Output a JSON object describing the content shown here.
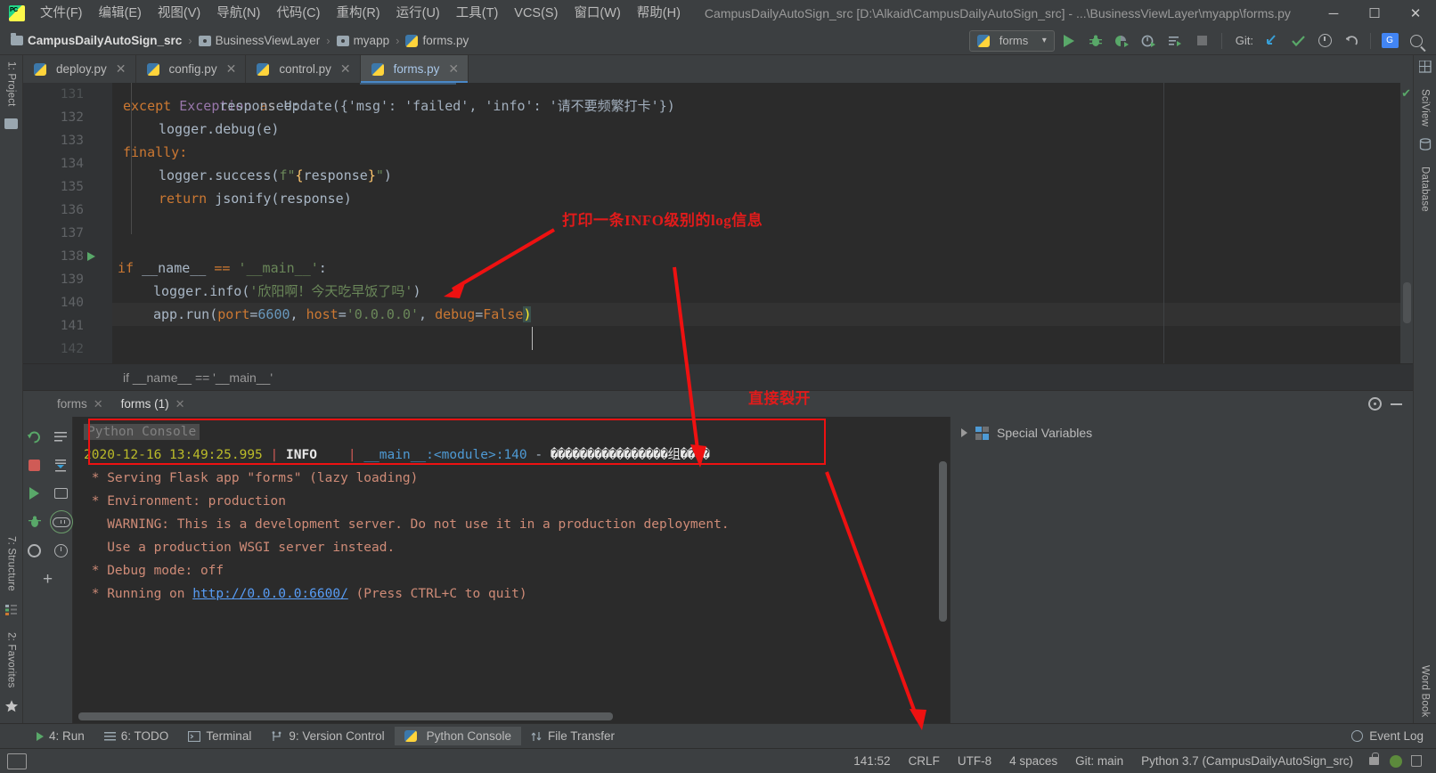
{
  "window": {
    "title": "CampusDailyAutoSign_src [D:\\Alkaid\\CampusDailyAutoSign_src] - ...\\BusinessViewLayer\\myapp\\forms.py",
    "minimize": "─",
    "maximize": "☐",
    "close": "✕"
  },
  "menu": {
    "items": [
      {
        "label": "文件(F)"
      },
      {
        "label": "编辑(E)"
      },
      {
        "label": "视图(V)"
      },
      {
        "label": "导航(N)"
      },
      {
        "label": "代码(C)"
      },
      {
        "label": "重构(R)"
      },
      {
        "label": "运行(U)"
      },
      {
        "label": "工具(T)"
      },
      {
        "label": "VCS(S)"
      },
      {
        "label": "窗口(W)"
      },
      {
        "label": "帮助(H)"
      }
    ]
  },
  "breadcrumbs": {
    "items": [
      {
        "label": "CampusDailyAutoSign_src",
        "icon": "folder-icon"
      },
      {
        "label": "BusinessViewLayer",
        "icon": "module-icon"
      },
      {
        "label": "myapp",
        "icon": "module-icon"
      },
      {
        "label": "forms.py",
        "icon": "python-file-icon"
      }
    ],
    "separator": "›"
  },
  "toolbar": {
    "run_config": "forms",
    "run_config_caret": "▾",
    "git_label": "Git:",
    "buttons": [
      "run-button",
      "debug-button",
      "run-coverage-button",
      "profile-button",
      "run-with-console-button",
      "stop-button"
    ],
    "git_buttons": [
      "git-update-button",
      "git-commit-button",
      "git-history-button",
      "git-rollback-button",
      "google-translate-button",
      "search-everywhere-button"
    ]
  },
  "editor_tabs": [
    {
      "label": "deploy.py",
      "active": false,
      "close": "✕"
    },
    {
      "label": "config.py",
      "active": false,
      "close": "✕"
    },
    {
      "label": "control.py",
      "active": false,
      "close": "✕"
    },
    {
      "label": "forms.py",
      "active": true,
      "close": "✕"
    }
  ],
  "editor": {
    "breadcrumb_text": "if __name__ == '__main__'",
    "lines": [
      {
        "num": "131",
        "partial": true
      },
      {
        "num": "132"
      },
      {
        "num": "133"
      },
      {
        "num": "134"
      },
      {
        "num": "135"
      },
      {
        "num": "136"
      },
      {
        "num": "137"
      },
      {
        "num": "138"
      },
      {
        "num": "139"
      },
      {
        "num": "140"
      },
      {
        "num": "141"
      },
      {
        "num": "142",
        "partial": true
      }
    ],
    "code": {
      "l131": "responseUpdate({'msg': 'failed', 'info': '请不要频繁打卡'})",
      "l132_kw": "except",
      "l132_exc": " Exception ",
      "l132_as": "as",
      "l132_e": " e:",
      "l133": "logger.debug(e)",
      "l134": "finally:",
      "l135_a": "logger.success(",
      "l135_f": "f",
      "l135_q1": "\"",
      "l135_b1": "{",
      "l135_resp": "response",
      "l135_b2": "}",
      "l135_q2": "\"",
      "l135_c": ")",
      "l136_ret": "return",
      "l136_rest": " jsonify(response)",
      "l139_if": "if",
      "l139_name": " __name__ ",
      "l139_eq": "==",
      "l139_main": " '__main__'",
      "l139_colon": ":",
      "l140_a": "logger.info(",
      "l140_s": "'欣阳啊！今天吃早饭了吗'",
      "l140_c": ")",
      "l141_a": "app.run(",
      "l141_port": "port",
      "l141_eq1": "=",
      "l141_6600": "6600",
      "l141_comma1": ", ",
      "l141_host": "host",
      "l141_eq2": "=",
      "l141_ip": "'0.0.0.0'",
      "l141_comma2": ", ",
      "l141_debug": "debug",
      "l141_eq3": "=",
      "l141_false": "False",
      "l141_c": ")"
    }
  },
  "console": {
    "tabs": [
      {
        "label": "forms",
        "active": false,
        "close": "✕"
      },
      {
        "label": "forms (1)",
        "active": true,
        "close": "✕"
      }
    ],
    "header_chip": "Python Console",
    "log": {
      "timestamp": "2020-12-16 13:49:25.995",
      "sep": "|",
      "level": "INFO",
      "location": "__main__:<module>:140",
      "dash": "-",
      "message_garbled": "����������������组����"
    },
    "output_lines": [
      " * Serving Flask app \"forms\" (lazy loading)",
      " * Environment: production",
      "   WARNING: This is a development server. Do not use it in a production deployment.",
      "   Use a production WSGI server instead.",
      " * Debug mode: off"
    ],
    "running_prefix": " * Running on ",
    "running_url": "http://0.0.0.0:6600/",
    "running_suffix": " (Press CTRL+C to quit)",
    "special_variables": "Special Variables"
  },
  "bottom_strip": {
    "items": [
      {
        "label": "4: Run",
        "icon": "run-icon",
        "active": false
      },
      {
        "label": "6: TODO",
        "icon": "todo-icon",
        "active": false
      },
      {
        "label": "Terminal",
        "icon": "terminal-icon",
        "active": false
      },
      {
        "label": "9: Version Control",
        "icon": "vcs-icon",
        "active": false
      },
      {
        "label": "Python Console",
        "icon": "python-console-icon",
        "active": true
      },
      {
        "label": "File Transfer",
        "icon": "file-transfer-icon",
        "active": false
      }
    ],
    "event_log": "Event Log"
  },
  "status_bar": {
    "caret": "141:52",
    "line_sep": "CRLF",
    "encoding": "UTF-8",
    "indent": "4 spaces",
    "branch": "Git: main",
    "interpreter": "Python 3.7 (CampusDailyAutoSign_src)"
  },
  "left_rail": {
    "project": "1: Project",
    "structure": "7: Structure",
    "favorites": "2: Favorites"
  },
  "right_rail": {
    "sciview": "SciView",
    "database": "Database",
    "word_book": "Word Book"
  },
  "annotations": {
    "note1": "打印一条INFO级别的log信息",
    "note2": "直接裂开"
  },
  "colors": {
    "accent_red": "#ee1111",
    "ide_bg": "#3c3f41",
    "editor_bg": "#2b2b2b",
    "green": "#59a869",
    "blue": "#589df6",
    "string_green": "#6a8759",
    "keyword_orange": "#cc7832"
  }
}
